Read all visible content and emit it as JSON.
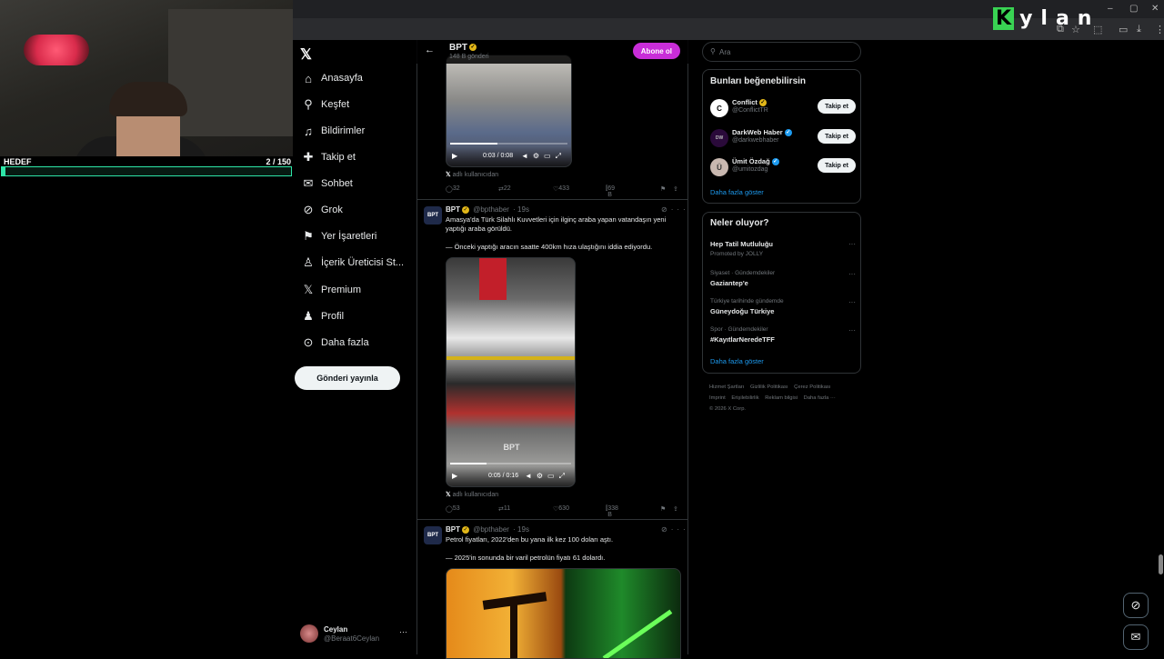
{
  "overlay": {
    "brand": "Kylan",
    "goal_label": "HEDEF",
    "goal_count": "2  / 150",
    "goal_progress": 0.013
  },
  "nav": {
    "items": [
      {
        "label": "Anasayfa",
        "icon": "home-icon"
      },
      {
        "label": "Keşfet",
        "icon": "search-icon"
      },
      {
        "label": "Bildirimler",
        "icon": "bell-icon"
      },
      {
        "label": "Takip et",
        "icon": "follow-icon"
      },
      {
        "label": "Sohbet",
        "icon": "chat-icon"
      },
      {
        "label": "Grok",
        "icon": "grok-icon"
      },
      {
        "label": "Yer İşaretleri",
        "icon": "bookmark-icon"
      },
      {
        "label": "İçerik Üreticisi St...",
        "icon": "creator-icon"
      },
      {
        "label": "Premium",
        "icon": "x-logo-icon"
      },
      {
        "label": "Profil",
        "icon": "profile-icon"
      },
      {
        "label": "Daha fazla",
        "icon": "more-icon"
      }
    ],
    "post_button": "Gönderi yayınla",
    "account": {
      "name": "Ceylan",
      "handle": "@Beraat6Ceylan",
      "more": "···"
    }
  },
  "header": {
    "title": "BPT",
    "subtitle": "148 B gönderi",
    "subscribe": "Abone ol"
  },
  "tweets": [
    {
      "video_time": "0:03 / 0:08",
      "video_progress": 0.4,
      "source_note": "adlı kullanıcıdan",
      "stats": {
        "replies": "32",
        "reposts": "22",
        "likes": "433",
        "views": "69 B"
      }
    },
    {
      "name": "BPT",
      "handle": "@bpthaber",
      "time": "· 19s",
      "avatar_text": "BPT",
      "text1": "Amasya'da Türk Silahlı Kuvvetleri için ilginç araba yapan vatandaşın yeni yaptığı araba görüldü.",
      "text2": "— Önceki yaptığı aracın saatte 400km hıza ulaştığını iddia ediyordu.",
      "video_time": "0:05 / 0:16",
      "video_progress": 0.3,
      "watermark": "BPT",
      "source_note": "adlı kullanıcıdan",
      "stats": {
        "replies": "53",
        "reposts": "11",
        "likes": "630",
        "views": "338 B"
      }
    },
    {
      "name": "BPT",
      "handle": "@bpthaber",
      "time": "· 19s",
      "avatar_text": "BPT",
      "text1": "Petrol fiyatları, 2022'den bu yana ilk kez 100 doları aştı.",
      "text2": "— 2025'in sonunda bir varil petrolün fiyatı 61 dolardı."
    }
  ],
  "right": {
    "search_placeholder": "Ara",
    "who_title": "Bunları beğenebilirsin",
    "who": [
      {
        "name": "Conflict",
        "handle": "@ConflictTR",
        "button": "Takip et",
        "verified": "gold"
      },
      {
        "name": "DarkWeb Haber",
        "handle": "@darkwebhaber",
        "button": "Takip et",
        "verified": "blue"
      },
      {
        "name": "Ümit Özdağ",
        "handle": "@umitozdag",
        "button": "Takip et",
        "verified": "blue"
      }
    ],
    "who_more": "Daha fazla göster",
    "trends_title": "Neler oluyor?",
    "trends": [
      {
        "category": "",
        "title": "Hep Tatil Mutluluğu",
        "subtitle": "Promoted by JOLLY"
      },
      {
        "category": "Siyaset · Gündemdekiler",
        "title": "Gaziantep'e",
        "subtitle": ""
      },
      {
        "category": "Türkiye tarihinde gündemde",
        "title": "Güneydoğu Türkiye",
        "subtitle": ""
      },
      {
        "category": "Spor · Gündemdekiler",
        "title": "#KayıtlarNeredeTFF",
        "subtitle": ""
      }
    ],
    "trends_more": "Daha fazla göster",
    "footer_links": [
      "Hizmet Şartları",
      "Gizlilik Politikası",
      "Çerez Politikası",
      "Imprint",
      "Erişilebilirlik",
      "Reklam bilgisi",
      "Daha fazla ···",
      "© 2026 X Corp."
    ]
  },
  "colors": {
    "accent": "#1d9bf0",
    "subscribe": "#c82dd8",
    "goal": "#2ee6a8",
    "brand_green": "#39d353"
  }
}
